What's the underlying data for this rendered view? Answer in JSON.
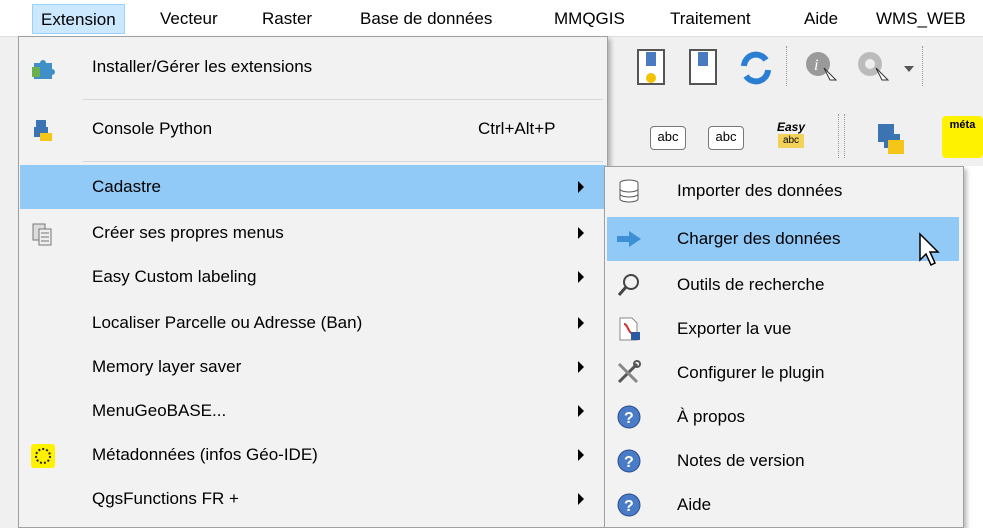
{
  "menubar": {
    "items": [
      {
        "label": "Extension"
      },
      {
        "label": "Vecteur"
      },
      {
        "label": "Raster"
      },
      {
        "label": "Base de données"
      },
      {
        "label": "MMQGIS"
      },
      {
        "label": "Traitement"
      },
      {
        "label": "Aide"
      },
      {
        "label": "WMS_WEB"
      }
    ]
  },
  "toolbar": {
    "label_tools": [
      "abc",
      "abc",
      "Easy"
    ],
    "easy_sub": "abc",
    "meta_badge": "méta"
  },
  "menu": {
    "items": [
      {
        "label": "Installer/Gérer les extensions",
        "icon": "puzzle-icon"
      },
      {
        "label": "Console Python",
        "shortcut": "Ctrl+Alt+P",
        "icon": "python-icon"
      },
      {
        "label": "Cadastre",
        "icon": ""
      },
      {
        "label": "Créer ses propres menus",
        "icon": "copy-menus-icon"
      },
      {
        "label": "Easy Custom labeling",
        "icon": ""
      },
      {
        "label": "Localiser Parcelle ou Adresse (Ban)",
        "icon": ""
      },
      {
        "label": "Memory layer saver",
        "icon": ""
      },
      {
        "label": "MenuGeoBASE...",
        "icon": ""
      },
      {
        "label": "Métadonnées (infos Géo-IDE)",
        "icon": "metadata-icon"
      },
      {
        "label": "QgsFunctions FR +",
        "icon": ""
      }
    ]
  },
  "submenu": {
    "items": [
      {
        "label": "Importer des données",
        "icon": "database-icon"
      },
      {
        "label": "Charger des données",
        "icon": "arrow-right-icon"
      },
      {
        "label": "Outils de recherche",
        "icon": "magnifier-icon"
      },
      {
        "label": "Exporter la vue",
        "icon": "pdf-export-icon"
      },
      {
        "label": "Configurer le plugin",
        "icon": "tools-icon"
      },
      {
        "label": "À propos",
        "icon": "help-icon"
      },
      {
        "label": "Notes de version",
        "icon": "help-icon"
      },
      {
        "label": "Aide",
        "icon": "help-icon"
      }
    ]
  },
  "colors": {
    "highlight": "#91c9f7",
    "menubar_active": "#cce8ff",
    "menu_bg": "#f2f2f2"
  }
}
